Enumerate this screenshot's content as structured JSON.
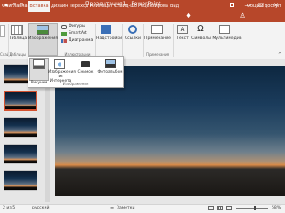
{
  "titlebar": {
    "title": "Презентация1 - PowerPoint",
    "user": "Alexey Ba...",
    "quick_access": [
      "save-icon",
      "undo-icon",
      "redo-icon",
      "present-icon"
    ],
    "window_buttons": {
      "minimize": "—",
      "maximize": "☐",
      "close": "✕"
    }
  },
  "tabs": [
    "Файл",
    "Главная",
    "Вставка",
    "Дизайн",
    "Переходы",
    "Анимация",
    "Слайд-шоу",
    "Рецензирование",
    "Вид"
  ],
  "active_tab": "Вставка",
  "tab_right": {
    "share": "Общий доступ"
  },
  "ribbon": {
    "slides": {
      "label": "Слайд"
    },
    "tables": {
      "table": "Таблица",
      "group": "Таблицы"
    },
    "images": {
      "button": "Изображения"
    },
    "illustrations": {
      "shapes": "Фигуры",
      "smartart": "SmartArt",
      "chart": "Диаграмма",
      "group": "Иллюстрации"
    },
    "addins": {
      "label": "Надстройки"
    },
    "links": {
      "label": "Ссылки"
    },
    "comments": {
      "note": "Примечание",
      "group": "Примечания"
    },
    "text": {
      "label": "Текст"
    },
    "symbols": {
      "label": "Символы"
    },
    "media": {
      "label": "Мультимедиа"
    }
  },
  "dropdown": {
    "pictures": "Рисунки",
    "online": "Изображения из Интернета",
    "screenshot": "Снимок",
    "album": "Фотоальбом",
    "group": "Изображения"
  },
  "slide_thumbnails": [
    1,
    2,
    3,
    4,
    5,
    6
  ],
  "status": {
    "slide_info": "2 из 5",
    "language": "русский",
    "notes": "Заметки",
    "zoom": "58%"
  },
  "colors": {
    "brand": "#b7472a",
    "selection": "#d35230",
    "ribbon_bg": "#f3f3f3",
    "panel_bg": "#e6e6e6"
  }
}
